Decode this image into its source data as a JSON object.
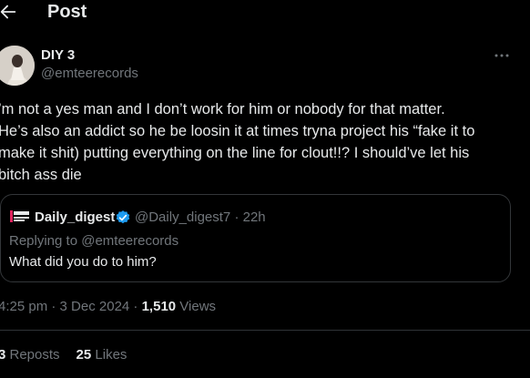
{
  "header": {
    "title": "Post",
    "back_icon": "arrow-left-icon"
  },
  "author": {
    "name": "DIY 3",
    "handle": "@emteerecords",
    "more_icon": "more-horizontal-icon"
  },
  "post": {
    "lines": [
      "’m not a yes  man and I don’t work for him or nobody for that matter.",
      "He’s also an addict so he be loosin it at times tryna project his “fake it to",
      "make it shit) putting everything on the line for clout!!? I should’ve let his",
      "bitch ass die"
    ]
  },
  "quote": {
    "logo_icon": "daily-digest-logo",
    "name": "Daily_digest",
    "verified_icon": "verified-badge-icon",
    "handle_time": "@Daily_digest7 · 22h",
    "reply_to": "Replying to @emteerecords",
    "text": "What did you do to him?"
  },
  "meta": {
    "time_date": "4:25 pm · 3 Dec 2024 · ",
    "views_count": "1,510",
    "views_label": " Views"
  },
  "stats": {
    "reposts_count": "3",
    "reposts_label": " Reposts",
    "likes_count": "25",
    "likes_label": " Likes"
  },
  "colors": {
    "background": "#000000",
    "text": "#e7e9ea",
    "secondary": "#71767b",
    "border": "#333639",
    "verified": "#1d9bf0"
  }
}
